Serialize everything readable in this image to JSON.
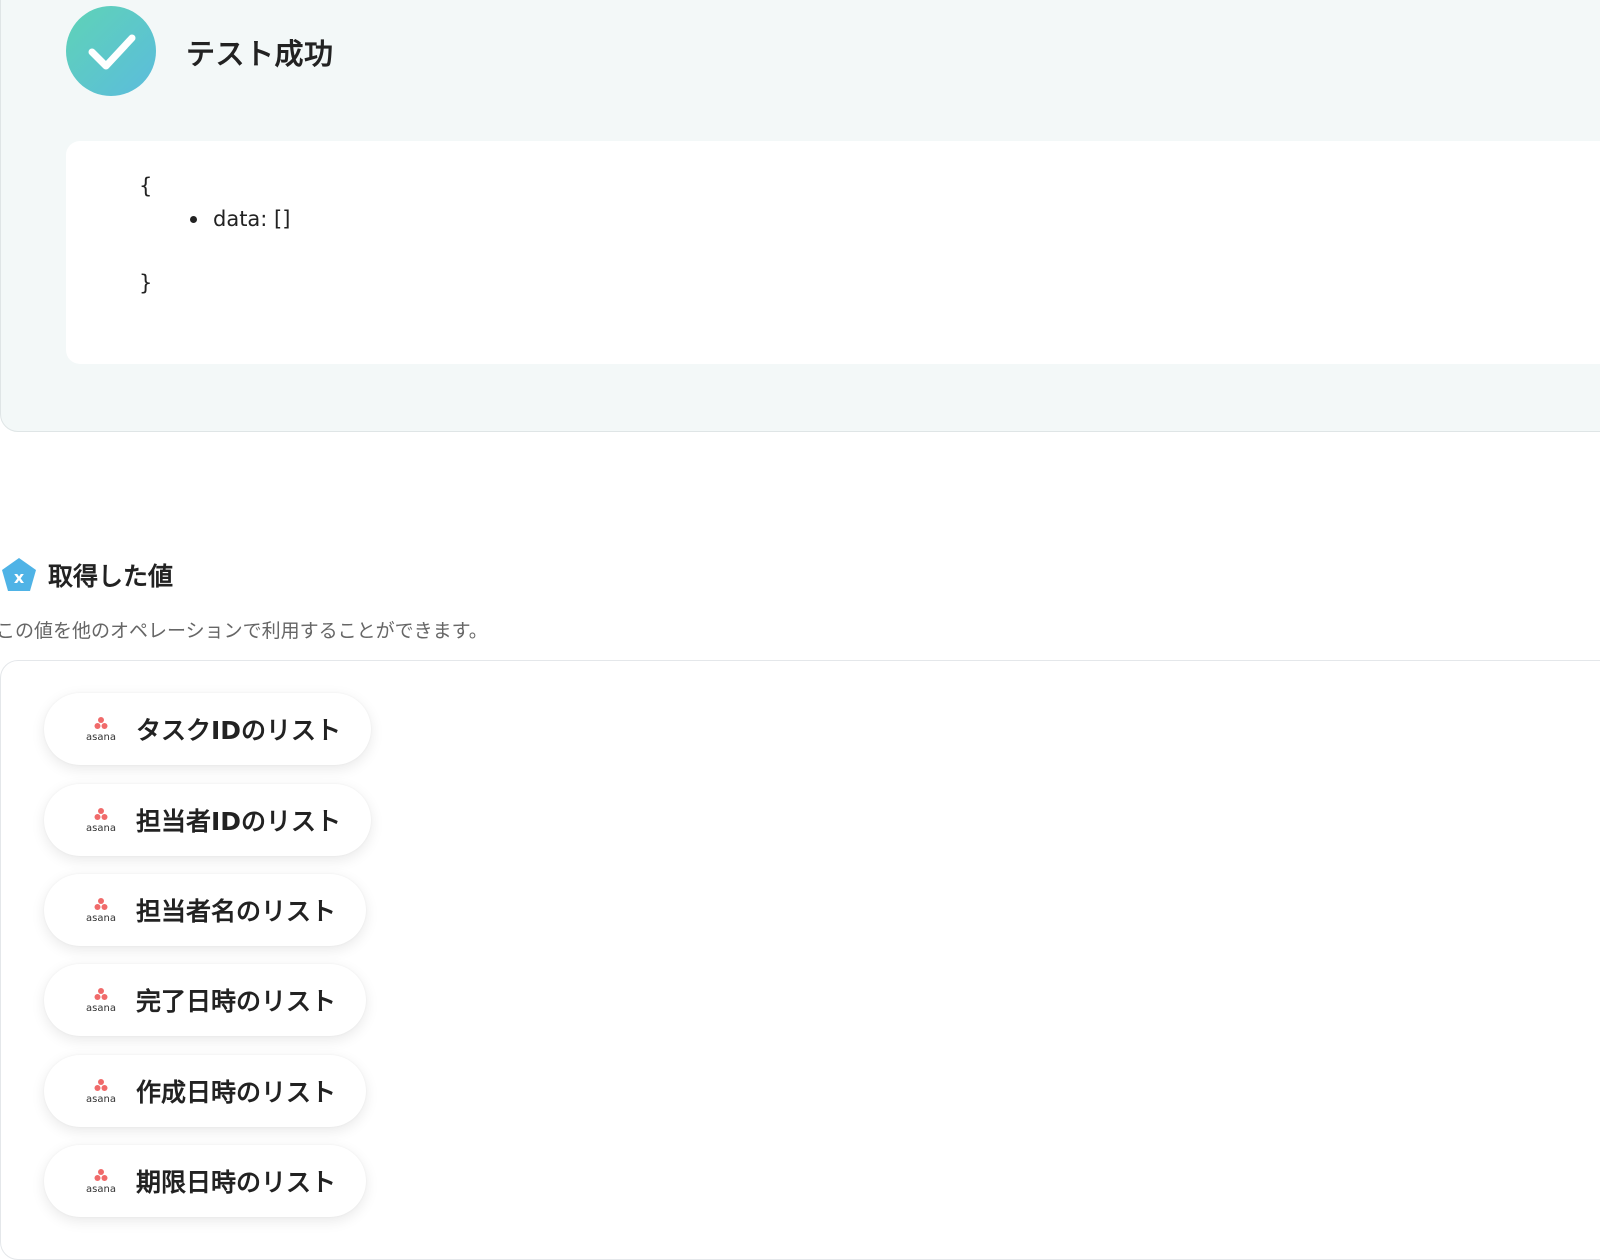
{
  "test_result": {
    "title": "テスト成功",
    "json_open": "{",
    "json_item": "data: []",
    "json_close": "}"
  },
  "values": {
    "title": "取得した値",
    "icon": "variable-x-icon",
    "description": "この値を他のオペレーションで利用することができます。",
    "items": [
      {
        "label": "タスクIDのリスト",
        "icon": "asana-logo"
      },
      {
        "label": "担当者IDのリスト",
        "icon": "asana-logo"
      },
      {
        "label": "担当者名のリスト",
        "icon": "asana-logo"
      },
      {
        "label": "完了日時のリスト",
        "icon": "asana-logo"
      },
      {
        "label": "作成日時のリスト",
        "icon": "asana-logo"
      },
      {
        "label": "期限日時のリスト",
        "icon": "asana-logo"
      }
    ],
    "asana_wordmark": "asana"
  },
  "colors": {
    "success_gradient_start": "#5fd3b6",
    "success_gradient_end": "#5bbcdd",
    "asana_red": "#f06a6a",
    "variable_icon": "#4fb3e6"
  }
}
